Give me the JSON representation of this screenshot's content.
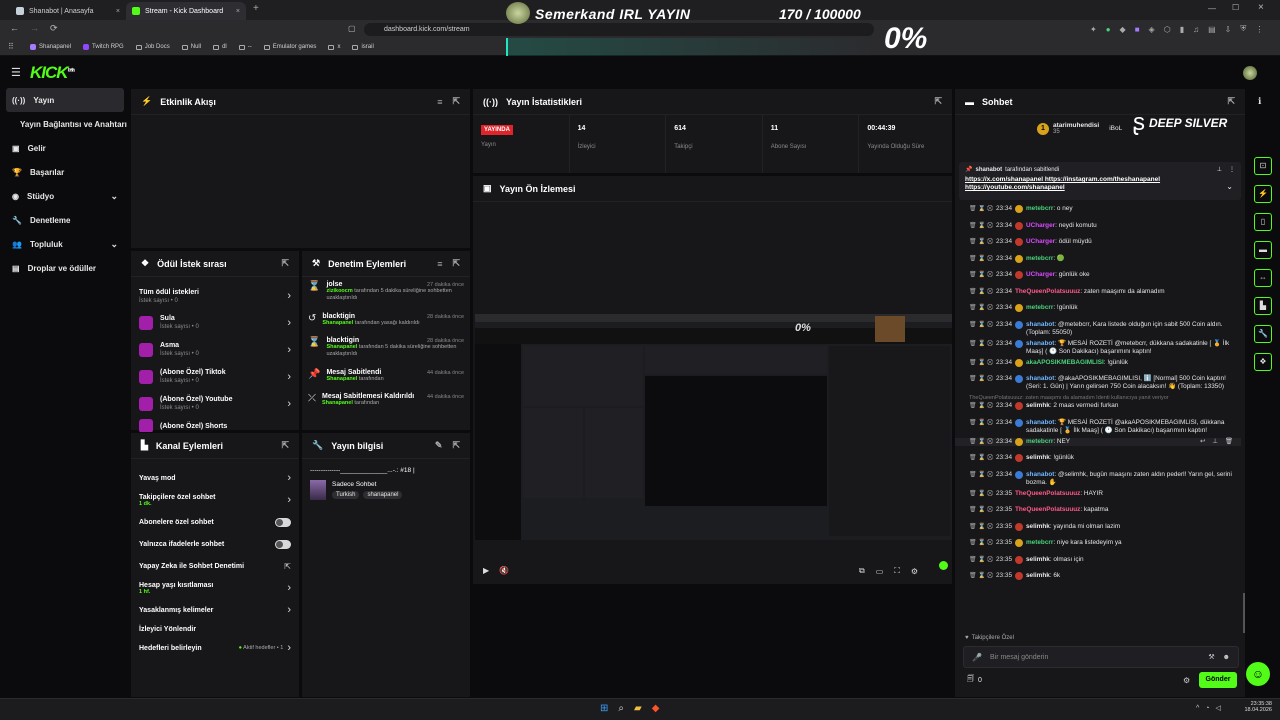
{
  "browser": {
    "tabs": [
      {
        "label": "Shanabot | Anasayfa",
        "active": false
      },
      {
        "label": "Stream - Kick Dashboard",
        "active": true
      }
    ],
    "url": "dashboard.kick.com/stream",
    "bookmarks": [
      "Shanapanel",
      "Twitch RPG",
      "Job Docs",
      "Null",
      "dl",
      "--",
      "Emulator games",
      "x",
      "israil"
    ]
  },
  "overlay": {
    "title": "Semerkand IRL YAYIN",
    "counter": "170 / 100000",
    "percent": "0%",
    "sponsor": "DEEP SILVER"
  },
  "app": {
    "logo": "KICK",
    "logo_sup": "beta"
  },
  "sidebar": {
    "items": [
      {
        "label": "Yayın",
        "icon": "stream-icon",
        "active": true
      },
      {
        "label": "Yayın Bağlantısı ve Anahtarı",
        "icon": "",
        "active": false
      },
      {
        "label": "Gelir",
        "icon": "money-icon",
        "active": false
      },
      {
        "label": "Başarılar",
        "icon": "trophy-icon",
        "active": false
      },
      {
        "label": "Stüdyo",
        "icon": "studio-icon",
        "active": false
      },
      {
        "label": "Denetleme",
        "icon": "wrench-icon",
        "active": false
      },
      {
        "label": "Topluluk",
        "icon": "community-icon",
        "active": false
      },
      {
        "label": "Droplar ve ödüller",
        "icon": "drops-icon",
        "active": false
      }
    ]
  },
  "activity": {
    "title": "Etkinlik Akışı"
  },
  "stats": {
    "title": "Yayın İstatistikleri",
    "live_badge": "YAYINDA",
    "items": [
      {
        "value": "",
        "label": "Yayın"
      },
      {
        "value": "14",
        "label": "İzleyici"
      },
      {
        "value": "614",
        "label": "Takipçi"
      },
      {
        "value": "11",
        "label": "Abone Sayısı"
      },
      {
        "value": "00:44:39",
        "label": "Yayında Olduğu Süre"
      }
    ]
  },
  "preview": {
    "title": "Yayın Ön İzlemesi"
  },
  "rewards": {
    "title": "Ödül İstek sırası",
    "items": [
      {
        "title": "Tüm ödül istekleri",
        "sub": "İstek sayısı • 0"
      },
      {
        "title": "Sula",
        "sub": "İstek sayısı • 0"
      },
      {
        "title": "Asma",
        "sub": "İstek sayısı • 0"
      },
      {
        "title": "(Abone Özel) Tiktok",
        "sub": "İstek sayısı • 0"
      },
      {
        "title": "(Abone Özel) Youtube",
        "sub": "İstek sayısı • 0"
      },
      {
        "title": "(Abone Özel) Shorts",
        "sub": ""
      }
    ]
  },
  "mod": {
    "title": "Denetim Eylemleri",
    "items": [
      {
        "title": "jolse",
        "time": "27 dakika önce",
        "actor": "zizikoocm",
        "text": "tarafından 5 dakika süreliğine sohbetten uzaklaştırıldı"
      },
      {
        "title": "blacktigin",
        "time": "28 dakika önce",
        "actor": "Shanapanel",
        "text": "tarafından yasağı kaldırıldı"
      },
      {
        "title": "blacktigin",
        "time": "28 dakika önce",
        "actor": "Shanapanel",
        "text": "tarafından 5 dakika süreliğine sohbetten uzaklaştırıldı"
      },
      {
        "title": "Mesaj Sabitlendi",
        "time": "44 dakika önce",
        "actor": "Shanapanel",
        "text": "tarafından"
      },
      {
        "title": "Mesaj Sabitlemesi Kaldırıldı",
        "time": "44 dakika önce",
        "actor": "Shanapanel",
        "text": "tarafından"
      }
    ]
  },
  "channel": {
    "title": "Kanal Eylemleri",
    "items": [
      {
        "title": "Yavaş mod",
        "sub": "",
        "ctrl": "chev"
      },
      {
        "title": "Takipçilere özel sohbet",
        "sub": "1 dk.",
        "ctrl": "chev"
      },
      {
        "title": "Abonelere özel sohbet",
        "sub": "",
        "ctrl": "toggle"
      },
      {
        "title": "Yalnızca ifadelerle sohbet",
        "sub": "",
        "ctrl": "toggle"
      },
      {
        "title": "Yapay Zeka ile Sohbet Denetimi",
        "sub": "",
        "ctrl": "ext"
      },
      {
        "title": "Hesap yaşı kısıtlaması",
        "sub": "1 hf.",
        "ctrl": "chev"
      },
      {
        "title": "Yasaklanmış kelimeler",
        "sub": "",
        "ctrl": "chev"
      },
      {
        "title": "İzleyici Yönlendir",
        "sub": "",
        "ctrl": ""
      },
      {
        "title": "Hedefleri belirleyin",
        "sub": "",
        "ctrl": "chev",
        "extra": "Aktif hedefler • 1"
      }
    ]
  },
  "info": {
    "title": "Yayın bilgisi",
    "stream_title": "--------------_____________...-.: #18 |",
    "category": "Sadece Sohbet",
    "tags": [
      "Turkish",
      "shanapanel"
    ]
  },
  "chat": {
    "title": "Sohbet",
    "top_user": "atarimuhendisi",
    "top_user_count": "35",
    "top_user2": "iBoL",
    "pinned_by": "shanabot",
    "pinned_suffix": "tarafından sabitlendi",
    "pinned_links": "https://x.com/shanapanel https://instagram.com/theshanapanel https://youtube.com/shanapanel",
    "reply_hint": "TheQueenPolatsuuuz: zaten maaşımı da alamadım Identi kullanıcıya yanıt veriyor",
    "messages": [
      {
        "time": "23:34",
        "user": "metebcrr",
        "color": "#4ad17a",
        "badge": "#d9a21b",
        "text": "o ney"
      },
      {
        "time": "23:34",
        "user": "UCharger",
        "color": "#d94aff",
        "badge": "#c0392b",
        "text": "neydi komutu"
      },
      {
        "time": "23:34",
        "user": "UCharger",
        "color": "#d94aff",
        "badge": "#c0392b",
        "text": "ödül müydü"
      },
      {
        "time": "23:34",
        "user": "metebcrr",
        "color": "#4ad17a",
        "badge": "#d9a21b",
        "text": "🟢"
      },
      {
        "time": "23:34",
        "user": "UCharger",
        "color": "#d94aff",
        "badge": "#c0392b",
        "text": "günlük oke"
      },
      {
        "time": "23:34",
        "user": "TheQueenPolatsuuuz",
        "color": "#ff5a8a",
        "badge": "",
        "text": "zaten maaşımı da alamadım"
      },
      {
        "time": "23:34",
        "user": "metebcrr",
        "color": "#4ad17a",
        "badge": "#d9a21b",
        "text": "!günlük"
      },
      {
        "time": "23:34",
        "user": "shanabot",
        "color": "#6fb6ff",
        "badge": "#3a7bd5",
        "text": "@metebcrr, Kara listede olduğun için sabit 500 Coin aldın. (Toplam: 55050)"
      },
      {
        "time": "23:34",
        "user": "shanabot",
        "color": "#6fb6ff",
        "badge": "#3a7bd5",
        "text": "🏆 MESAİ ROZETİ @metebcrr, dükkana sadakatinle [ 🏅 İlk Maaş] ( 🕐 Son Dakikacı) başarımını kaptın!"
      },
      {
        "time": "23:34",
        "user": "akaAPOSIKMEBAGIMLISI",
        "color": "#4ad17a",
        "badge": "#d9a21b",
        "text": "!günlük"
      },
      {
        "time": "23:34",
        "user": "shanabot",
        "color": "#6fb6ff",
        "badge": "#3a7bd5",
        "text": "@akaAPOSIKMEBAGIMLISI, ℹ️ [Normal] 500 Coin kaptın! (Seri: 1. Gün) | Yarın gelirsen 750 Coin alacaksın! 👋 (Toplam: 13350)"
      },
      {
        "time": "23:34",
        "user": "selimhk",
        "color": "#e8e8e8",
        "badge": "#c0392b",
        "text": "2 maas vermedi furkan"
      },
      {
        "time": "23:34",
        "user": "shanabot",
        "color": "#6fb6ff",
        "badge": "#3a7bd5",
        "text": "🏆 MESAİ ROZETİ @akaAPOSIKMEBAGIMLISI, dükkana sadakatinle [ 🏅 İlk Maaş] ( 🕐 Son Dakikacı) başarımını kaptın!"
      },
      {
        "time": "23:34",
        "user": "metebcrr",
        "color": "#4ad17a",
        "badge": "#d9a21b",
        "text": "NEY"
      },
      {
        "time": "23:34",
        "user": "selimhk",
        "color": "#e8e8e8",
        "badge": "#c0392b",
        "text": "!günlük"
      },
      {
        "time": "23:34",
        "user": "shanabot",
        "color": "#6fb6ff",
        "badge": "#3a7bd5",
        "text": "@selimhk, bugün maaşını zaten aldın pederl! Yarın gel, serini bozma. ✋"
      },
      {
        "time": "23:35",
        "user": "TheQueenPolatsuuuz",
        "color": "#ff5a8a",
        "badge": "",
        "text": "HAYIR"
      },
      {
        "time": "23:35",
        "user": "TheQueenPolatsuuuz",
        "color": "#ff5a8a",
        "badge": "",
        "text": "kapatma"
      },
      {
        "time": "23:35",
        "user": "selimhk",
        "color": "#e8e8e8",
        "badge": "#c0392b",
        "text": "yayında mi olman lazim"
      },
      {
        "time": "23:35",
        "user": "metebcrr",
        "color": "#4ad17a",
        "badge": "#d9a21b",
        "text": "niye kara listedeyim ya"
      },
      {
        "time": "23:35",
        "user": "selimhk",
        "color": "#e8e8e8",
        "badge": "#c0392b",
        "text": "olması için"
      },
      {
        "time": "23:35",
        "user": "selimhk",
        "color": "#e8e8e8",
        "badge": "#c0392b",
        "text": "6k"
      }
    ],
    "followers_only": "Takipçilere Özel",
    "input_placeholder": "Bir mesaj gönderin",
    "send_label": "Gönder",
    "viewer_count": "0"
  },
  "taskbar": {
    "time": "23:35:38",
    "date": "18.04.2026"
  },
  "colors": {
    "accent": "#53fc18",
    "live": "#e0242b",
    "bg": "#0b0b0d",
    "panel": "#17171a"
  }
}
